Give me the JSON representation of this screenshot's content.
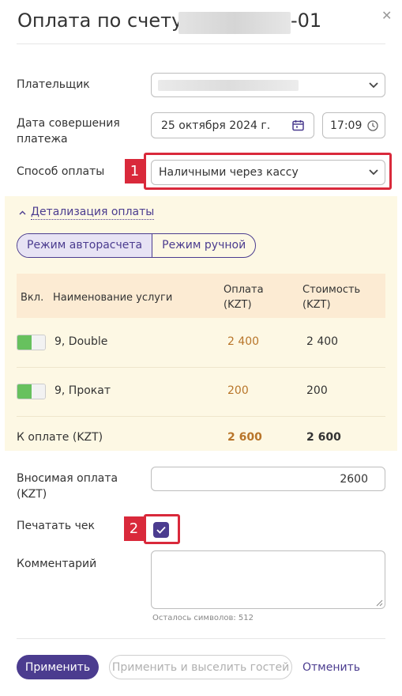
{
  "header": {
    "title": "Оплата по счету",
    "title_suffix": "-01"
  },
  "form": {
    "payer_label": "Плательщик",
    "date_label": "Дата совершения платежа",
    "date_value": "25 октября 2024 г.",
    "time_value": "17:09",
    "method_label": "Способ оплаты",
    "method_value": "Наличными через кассу",
    "details_toggle": "Детализация оплаты",
    "modes": [
      "Режим авторасчета",
      "Режим ручной"
    ],
    "table": {
      "headers": {
        "enabled": "Вкл.",
        "service": "Наименование услуги",
        "payment": "Оплата (KZT)",
        "cost": "Стоимость (KZT)"
      },
      "rows": [
        {
          "service": "9, Double",
          "payment": "2 400",
          "cost": "2 400"
        },
        {
          "service": "9, Прокат",
          "payment": "200",
          "cost": "200"
        }
      ],
      "total_label": "К оплате (KZT)",
      "total_payment": "2 600",
      "total_cost": "2 600"
    },
    "amount_label": "Вносимая оплата (KZT)",
    "amount_value": "2600",
    "print_label": "Печатать чек",
    "comment_label": "Комментарий",
    "chars_left": "Осталось символов: 512"
  },
  "annotations": [
    "1",
    "2"
  ],
  "buttons": {
    "apply": "Применить",
    "apply_checkout": "Применить и выселить гостей",
    "cancel": "Отменить"
  },
  "colors": {
    "accent": "#4b3c8f",
    "highlight_red": "#d9293b",
    "panel_bg": "#fdf8e4",
    "table_header_bg": "#fcebd3",
    "toggle_green": "#67c15e",
    "amount_orange": "#b8752a"
  }
}
